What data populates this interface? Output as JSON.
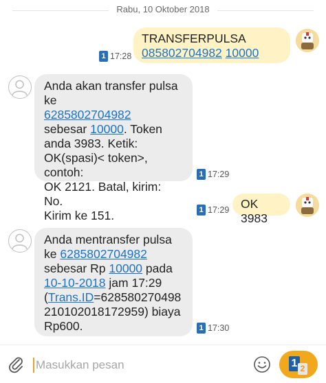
{
  "date_separator": "Rabu, 10 Oktober 2018",
  "messages": [
    {
      "direction": "outgoing",
      "line1": "TRANSFERPULSA",
      "number": "085802704982",
      "amount": "10000",
      "sim": "1",
      "time": "17:28"
    },
    {
      "direction": "incoming",
      "prefix": "Anda akan transfer pulsa ke",
      "number": "6285802704982",
      "mid1": "sebesar",
      "amount": "10000",
      "rest1": ". Token",
      "line3": "anda 3983. Ketik:",
      "line4": "OK(spasi)< token>, contoh:",
      "line5": "OK 2121. Batal, kirim: No.",
      "line6": "Kirim ke 151.",
      "sim": "1",
      "time": "17:29"
    },
    {
      "direction": "outgoing",
      "text": "OK 3983",
      "sim": "1",
      "time": "17:29"
    },
    {
      "direction": "incoming",
      "prefix": "Anda mentransfer pulsa",
      "ke": "ke",
      "number": "6285802704982",
      "mid1": "sebesar Rp",
      "amount": "10000",
      "mid2": "pada",
      "date": "10-10-2018",
      "mid3": "jam 17:29",
      "open_paren": "(",
      "trans_id_label": "Trans.ID",
      "trans_id_value": "=628580270498",
      "line6": "210102018172959) biaya",
      "line7": "Rp600.",
      "sim": "1",
      "time": "17:30"
    }
  ],
  "composer": {
    "placeholder": "Masukkan pesan",
    "send_sim_primary": "1",
    "send_sim_secondary": "2"
  },
  "colors": {
    "outgoing_bubble": "#fff3c6",
    "incoming_bubble": "#ececec",
    "link": "#1a73c8",
    "send_button": "#f2a81c",
    "sim_badge": "#2a6fb3"
  },
  "icons": {
    "attach": "paperclip-icon",
    "emoji": "smiley-icon",
    "contact": "person-outline-icon",
    "self_avatar": "cartoon-avatar-icon"
  }
}
